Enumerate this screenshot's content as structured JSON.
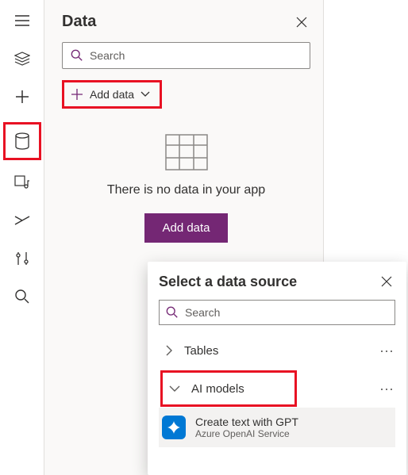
{
  "panel": {
    "title": "Data",
    "search_placeholder": "Search",
    "add_data_label": "Add data"
  },
  "empty": {
    "message": "There is no data in your app",
    "cta": "Add data"
  },
  "popup": {
    "title": "Select a data source",
    "search_placeholder": "Search",
    "sections": {
      "tables": "Tables",
      "ai_models": "AI models"
    },
    "item": {
      "title": "Create text with GPT",
      "subtitle": "Azure OpenAI Service"
    }
  },
  "colors": {
    "highlight": "#e81123",
    "primary": "#742774",
    "accent": "#0078d4"
  }
}
